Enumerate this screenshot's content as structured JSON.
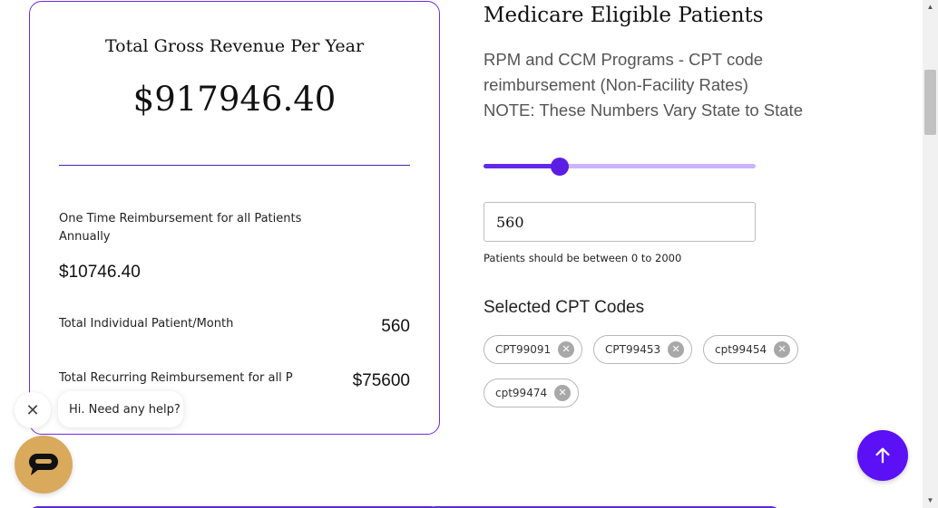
{
  "summary": {
    "title": "Total Gross Revenue Per Year",
    "amount": "$917946.40",
    "one_time_label": "One Time Reimbursement for all Patients Annually",
    "one_time_value": "$10746.40",
    "individual_label": "Total Individual Patient/Month",
    "individual_value": "560",
    "recurring_label": "Total Recurring Reimbursement for all P",
    "recurring_value": "$75600"
  },
  "calculator": {
    "title": "Medicare Eligible Patients",
    "desc_line1": "RPM and CCM Programs - CPT code",
    "desc_line2": "reimbursement (Non-Facility Rates)",
    "desc_line3": "NOTE: These Numbers Vary State to State",
    "patients_value": "560",
    "patients_min": 0,
    "patients_max": 2000,
    "slider_fraction": 0.28,
    "hint": "Patients should be between 0 to 2000",
    "codes_title": "Selected CPT Codes",
    "codes": [
      "CPT99091",
      "CPT99453",
      "cpt99454",
      "cpt99474"
    ],
    "remove_glyph": "✕"
  },
  "chat": {
    "close_glyph": "✕",
    "message": "Hi. Need any help?"
  },
  "scrollbar": {
    "up_glyph": "▲",
    "down_glyph": "▼"
  },
  "colors": {
    "accent": "#5b10f5",
    "card_border": "#6a2be0",
    "chat_launcher": "#d9a95c"
  },
  "icons": {
    "scroll_top": "arrow-up-icon",
    "chat": "chat-icon"
  }
}
